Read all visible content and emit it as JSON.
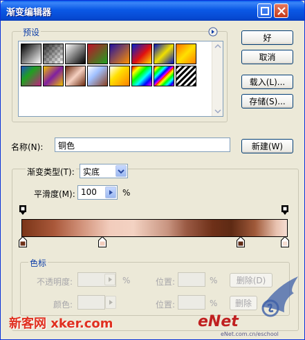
{
  "window": {
    "title": "渐变编辑器"
  },
  "presets": {
    "group_label": "预设",
    "swatches": [
      [
        "#000000",
        "#ffffff"
      ],
      [
        "checker-gray",
        "transparent"
      ],
      [
        "#000000",
        "#ffffff"
      ],
      [
        "#cc2020",
        "#1a9a20"
      ],
      [
        "#3010a0",
        "#ff9000"
      ],
      [
        "#e01010",
        "#0020d0"
      ],
      [
        "#0010c0",
        "#f0e000"
      ],
      [
        "#ffe000",
        "#ff8000"
      ],
      [
        "#30209a",
        "#20a020"
      ],
      [
        "#f0c000",
        "#a020a0"
      ],
      [
        "#6a2a10",
        "#f5d0c0"
      ],
      [
        "#a0c0ff",
        "#6a2a10"
      ],
      [
        "rainbow",
        "rainbow"
      ],
      [
        "rainbow",
        "rainbow"
      ],
      [
        "rainbow",
        "rainbow"
      ],
      [
        "stripes",
        "stripes"
      ]
    ]
  },
  "buttons": {
    "ok": "好",
    "cancel": "取消",
    "load": "载入(L)...",
    "save": "存储(S)...",
    "new": "新建(W)",
    "delete1": "删除(D)",
    "delete2": "删除"
  },
  "name": {
    "label": "名称(N):",
    "value": "铜色"
  },
  "gradient_type": {
    "label": "渐变类型(T):",
    "value": "实底"
  },
  "smoothness": {
    "label": "平滑度(M):",
    "value": "100",
    "unit": "%"
  },
  "color_stops": {
    "group_label": "色标",
    "opacity_label": "不透明度:",
    "percent1": "%",
    "location_label": "位置:",
    "percent2": "%",
    "color_label": "颜色:",
    "location_label2": "位置:",
    "percent3": "%"
  },
  "watermarks": {
    "left": "新客网 xker.com",
    "right": "eNet.com.cn/eschool",
    "right_logo": "eNet"
  },
  "colors": {
    "copper_dark": "#5e2a14",
    "copper_mid": "#a5583a",
    "copper_light": "#f2ccbc",
    "title_blue": "#0a5ded",
    "label_blue": "#0d3ea8"
  }
}
